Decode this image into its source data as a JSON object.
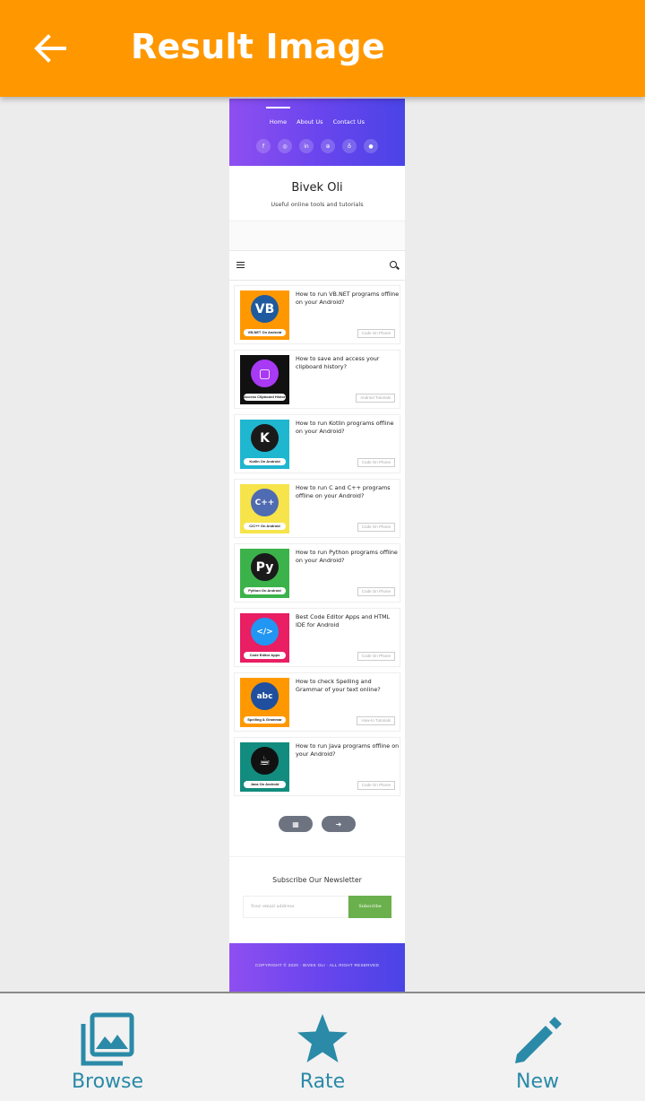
{
  "appbar": {
    "title": "Result Image"
  },
  "preview": {
    "nav": [
      "Home",
      "About Us",
      "Contact Us"
    ],
    "socials": [
      "f",
      "◎",
      "in",
      "⊕",
      "♁",
      "●"
    ],
    "brand": {
      "name": "Bivek Oli",
      "tagline": "Useful online tools and tutorials"
    },
    "posts": [
      {
        "title": "How to run VB.NET programs offline on your Android?",
        "category": "Code On Phone",
        "thumb_bg": "#ff9800",
        "icon_bg": "#1f5a9e",
        "icon_text": "VB",
        "tag": "VB.NET On Android"
      },
      {
        "title": "How to save and access your clipboard history?",
        "category": "Android Tutorials",
        "thumb_bg": "#111111",
        "icon_bg": "#a839f4",
        "icon_text": "▢",
        "tag": "Access Clipboard History"
      },
      {
        "title": "How to run Kotlin programs offline on your Android?",
        "category": "Code On Phone",
        "thumb_bg": "#1fb6d0",
        "icon_bg": "#1a1a1a",
        "icon_text": "K",
        "tag": "Kotlin On Android"
      },
      {
        "title": "How to run C and C++ programs offline on your Android?",
        "category": "Code On Phone",
        "thumb_bg": "#f6e44a",
        "icon_bg": "#4f6bb1",
        "icon_text": "C++",
        "tag": "C/C++ On Android"
      },
      {
        "title": "How to run Python programs offline on your Android?",
        "category": "Code On Phone",
        "thumb_bg": "#3bb34a",
        "icon_bg": "#1a1a1a",
        "icon_text": "Py",
        "tag": "Python On Android"
      },
      {
        "title": "Best Code Editor Apps and HTML IDE for Android",
        "category": "Code On Phone",
        "thumb_bg": "#e91e63",
        "icon_bg": "#2196f3",
        "icon_text": "</>",
        "tag": "Code Editor Apps"
      },
      {
        "title": "How to check Spelling and Grammar of your text online?",
        "category": "How-to Tutorials",
        "thumb_bg": "#ff9800",
        "icon_bg": "#1f4f9e",
        "icon_text": "abc",
        "tag": "Spelling & Grammar"
      },
      {
        "title": "How to run Java programs offline on your Android?",
        "category": "Code On Phone",
        "thumb_bg": "#128c7e",
        "icon_bg": "#111111",
        "icon_text": "☕",
        "tag": "Java On Android"
      }
    ],
    "pager": [
      "▦",
      "➜"
    ],
    "newsletter": {
      "title": "Subscribe Our Newsletter",
      "placeholder": "Your email address",
      "button": "Subscribe"
    },
    "footer": "COPYRIGHT © 2020 · BIVEK OLI · ALL RIGHT RESERVED"
  },
  "bottomnav": {
    "items": [
      {
        "label": "Browse",
        "icon": "gallery-icon"
      },
      {
        "label": "Rate",
        "icon": "star-icon"
      },
      {
        "label": "New",
        "icon": "pencil-icon"
      }
    ],
    "color": "#2a8aa8"
  }
}
